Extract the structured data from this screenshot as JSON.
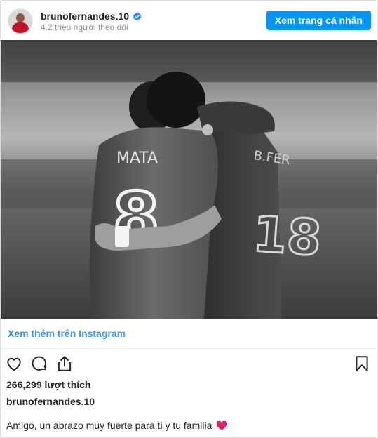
{
  "header": {
    "username": "brunofernandes.10",
    "followers": "4.2 triệu người theo dõi",
    "profile_button": "Xem trang cá nhân"
  },
  "photo": {
    "jersey_left_name": "MATA",
    "jersey_left_number": "8",
    "jersey_right_name": "B.FER",
    "jersey_right_number": "18"
  },
  "more_link": "Xem thêm trên Instagram",
  "actions": {
    "icons": [
      "heart-icon",
      "comment-icon",
      "share-icon",
      "bookmark-icon"
    ]
  },
  "likes": "266,299 lượt thích",
  "caption": {
    "username": "brunofernandes.10",
    "text": "Amigo, un abrazo muy fuerte para ti y tu familia"
  },
  "colors": {
    "button": "#0095f6",
    "link": "#3897f0",
    "verified": "#3897f0",
    "heart_emoji": "#e0245e"
  }
}
